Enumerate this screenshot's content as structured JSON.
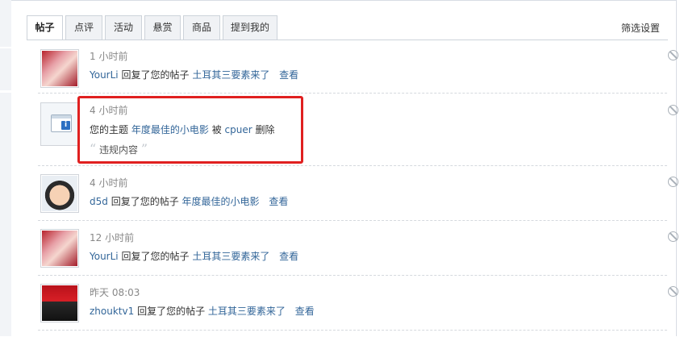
{
  "tabs": [
    {
      "label": "帖子",
      "active": true
    },
    {
      "label": "点评",
      "active": false
    },
    {
      "label": "活动",
      "active": false
    },
    {
      "label": "悬赏",
      "active": false
    },
    {
      "label": "商品",
      "active": false
    },
    {
      "label": "提到我的",
      "active": false
    }
  ],
  "filter_label": "筛选设置",
  "notifications": [
    {
      "avatar": "anime-girl-avatar",
      "time": "1 小时前",
      "user": "YourLi",
      "action": "回复了您的帖子",
      "post": "土耳其三要素来了",
      "view": "查看"
    },
    {
      "avatar": "system-notice-icon",
      "time": "4 小时前",
      "prefix": "您的主题",
      "post": "年度最佳的小电影",
      "by": "被",
      "user": "cpuer",
      "action": "删除",
      "reason": "违规内容"
    },
    {
      "avatar": "cartoon-kid-avatar",
      "time": "4 小时前",
      "user": "d5d",
      "action": "回复了您的帖子",
      "post": "年度最佳的小电影",
      "view": "查看"
    },
    {
      "avatar": "anime-girl-avatar",
      "time": "12 小时前",
      "user": "YourLi",
      "action": "回复了您的帖子",
      "post": "土耳其三要素来了",
      "view": "查看"
    },
    {
      "avatar": "man-in-suit-avatar",
      "time": "昨天 08:03",
      "user": "zhouktv1",
      "action": "回复了您的帖子",
      "post": "土耳其三要素来了",
      "view": "查看"
    }
  ],
  "colors": {
    "link": "#336699",
    "highlight_box": "#e02020",
    "time": "#888888"
  }
}
